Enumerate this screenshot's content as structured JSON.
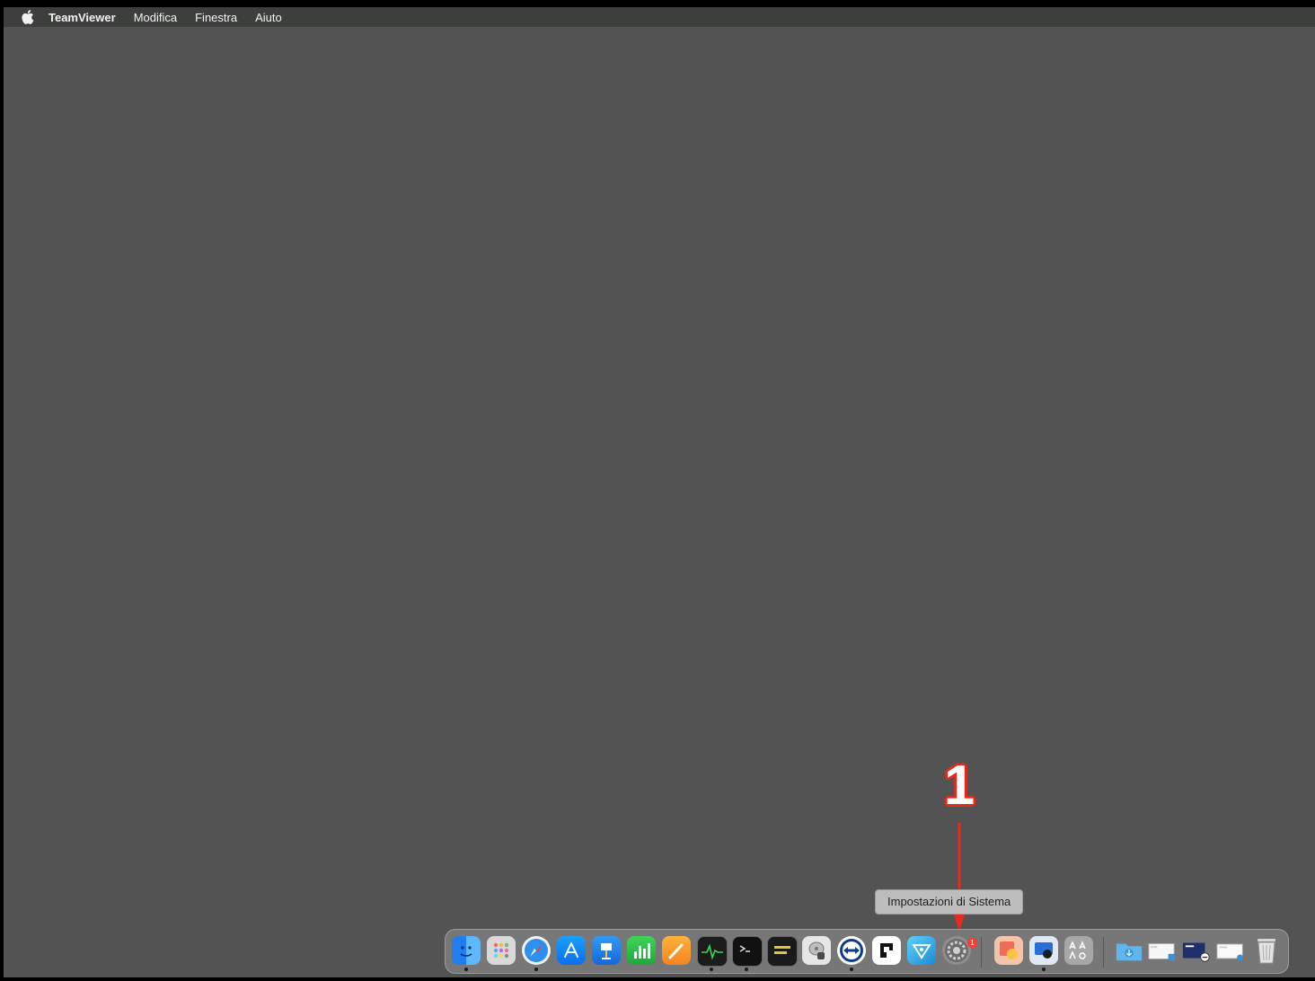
{
  "menubar": {
    "app_name": "TeamViewer",
    "items": [
      "Modifica",
      "Finestra",
      "Aiuto"
    ]
  },
  "annotation": {
    "step_number": "1",
    "color": "#e8291b"
  },
  "tooltip": {
    "text": "Impostazioni di Sistema"
  },
  "dock": {
    "apps": [
      {
        "name": "finder-icon",
        "running": true
      },
      {
        "name": "launchpad-icon",
        "running": false
      },
      {
        "name": "safari-icon",
        "running": true
      },
      {
        "name": "app-store-icon",
        "running": false
      },
      {
        "name": "keynote-icon",
        "running": false
      },
      {
        "name": "numbers-icon",
        "running": false
      },
      {
        "name": "pages-icon",
        "running": false
      },
      {
        "name": "activity-monitor-icon",
        "running": true
      },
      {
        "name": "terminal-icon",
        "running": true
      },
      {
        "name": "console-icon",
        "running": false
      },
      {
        "name": "disk-utility-icon",
        "running": false
      },
      {
        "name": "teamviewer-icon",
        "running": true
      },
      {
        "name": "app-icon",
        "running": false
      },
      {
        "name": "testflight-icon",
        "running": false
      },
      {
        "name": "system-settings-icon",
        "running": false,
        "badge": "1"
      },
      {
        "name": "preview-icon",
        "running": false
      },
      {
        "name": "remote-desktop-icon",
        "running": true
      },
      {
        "name": "font-book-icon",
        "running": false
      },
      {
        "name": "downloads-folder-icon",
        "running": false
      },
      {
        "name": "screenshot-file-icon",
        "running": false
      },
      {
        "name": "screenshot-file-icon-2",
        "running": false
      },
      {
        "name": "screenshot-file-icon-3",
        "running": false
      },
      {
        "name": "trash-icon",
        "running": false
      }
    ]
  }
}
